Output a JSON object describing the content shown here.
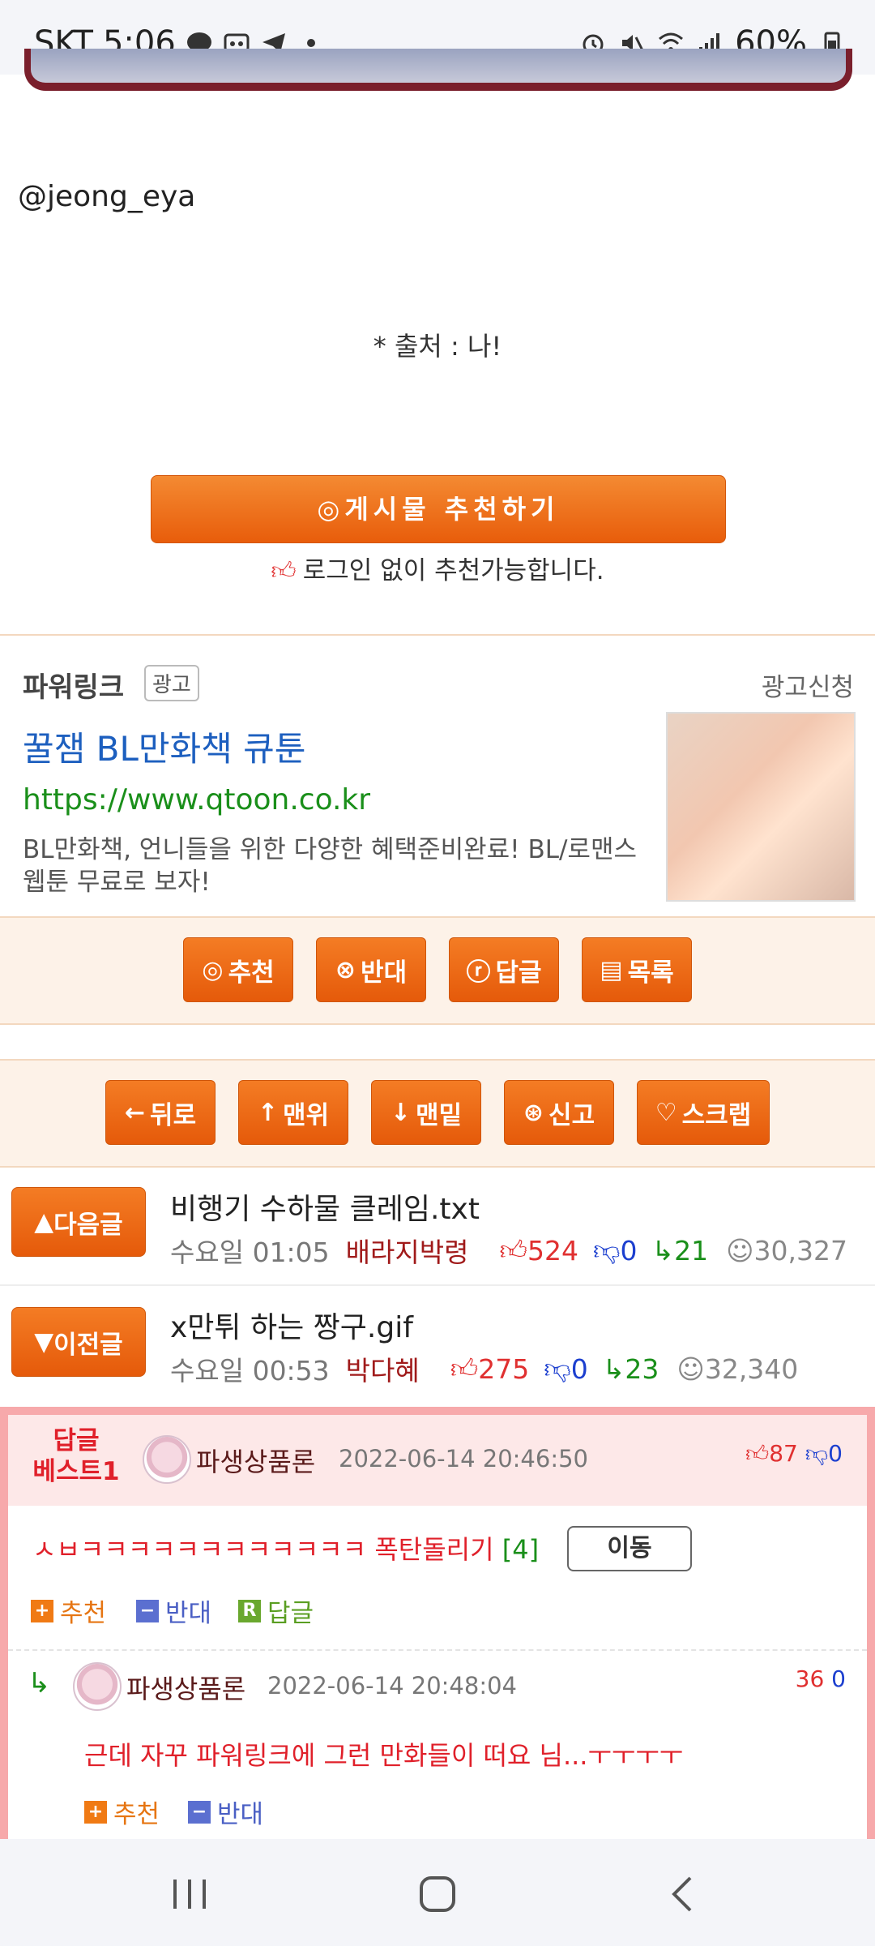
{
  "status_bar": {
    "carrier": "SKT",
    "time": "5:06",
    "battery": "60%"
  },
  "post": {
    "author_handle": "@jeong_eya",
    "source_note": "* 출처 : 나!",
    "recommend_button": "게시물 추천하기",
    "recommend_note": "로그인 없이 추천가능합니다."
  },
  "powerlink": {
    "title": "파워링크",
    "ad_badge": "광고",
    "ad_request": "광고신청",
    "headline": "꿀잼 BL만화책 큐툰",
    "url": "https://www.qtoon.co.kr",
    "description": "BL만화책, 언니들을 위한 다양한 혜택준비완료! BL/로맨스 웹툰 무료로 보자!"
  },
  "actions_row1": [
    {
      "icon": "recommend-icon",
      "label": "추천"
    },
    {
      "icon": "oppose-icon",
      "label": "반대"
    },
    {
      "icon": "reply-icon",
      "label": "답글"
    },
    {
      "icon": "list-icon",
      "label": "목록"
    }
  ],
  "actions_row2": [
    {
      "icon": "back-arrow-icon",
      "label": "뒤로"
    },
    {
      "icon": "up-arrow-icon",
      "label": "맨위"
    },
    {
      "icon": "down-arrow-icon",
      "label": "맨밑"
    },
    {
      "icon": "report-icon",
      "label": "신고"
    },
    {
      "icon": "heart-icon",
      "label": "스크랩"
    }
  ],
  "next_post": {
    "button": "다음글",
    "title": "비행기 수하물 클레임.txt",
    "time": "수요일 01:05",
    "author": "배라지박령",
    "up": "524",
    "down": "0",
    "replies": "21",
    "views": "30,327"
  },
  "prev_post": {
    "button": "이전글",
    "title": "x만튀 하는 짱구.gif",
    "time": "수요일 00:53",
    "author": "박다혜",
    "up": "275",
    "down": "0",
    "replies": "23",
    "views": "32,340"
  },
  "best_reply": {
    "label_line1": "답글",
    "label_line2": "베스트1",
    "name": "파생상품론",
    "date": "2022-06-14 20:46:50",
    "up": "87",
    "down": "0",
    "text": "ㅅㅂㅋㅋㅋㅋㅋㅋㅋㅋㅋㅋㅋㅋ 폭탄돌리기",
    "count": "[4]",
    "move_button": "이동",
    "act_recommend": "추천",
    "act_oppose": "반대",
    "act_reply": "답글"
  },
  "sub_reply": {
    "name": "파생상품론",
    "date": "2022-06-14 20:48:04",
    "up": "36",
    "down": "0",
    "text": "근데 자꾸 파워링크에 그런 만화들이 떠요 님...ㅜㅜㅜㅜ",
    "act_recommend": "추천",
    "act_oppose": "반대"
  }
}
